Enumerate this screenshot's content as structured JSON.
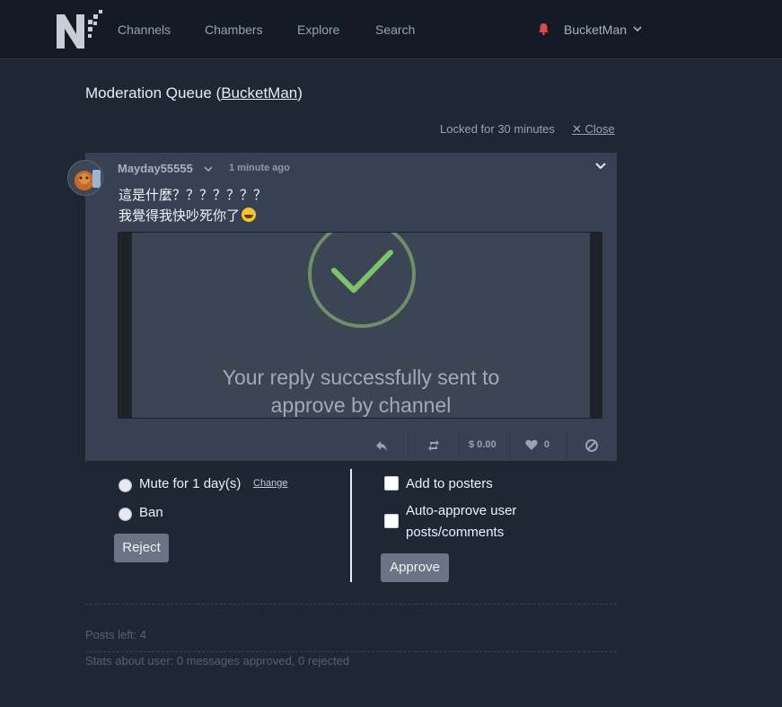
{
  "nav": {
    "links": [
      "Channels",
      "Chambers",
      "Explore",
      "Search"
    ],
    "user": "BucketMan"
  },
  "page": {
    "title_prefix": "Moderation Queue (",
    "title_user": "BucketMan",
    "title_suffix": ")",
    "locked_text": "Locked for 30 minutes",
    "close_label": "✕ Close"
  },
  "post": {
    "author": "Mayday55555",
    "time": "1 minute ago",
    "lines": [
      "這是什麼？？？？？？？",
      "我覺得我快吵死你了"
    ],
    "image_text": [
      "Your reply successfully sent to",
      "approve by channel"
    ],
    "tip_amount": "$ 0.00",
    "like_count": "0"
  },
  "moderation": {
    "mute_label": "Mute for 1 day(s)",
    "change_label": "Change",
    "ban_label": "Ban",
    "reject_label": "Reject",
    "add_posters_label": "Add to posters",
    "auto_approve_line1": "Auto-approve user",
    "auto_approve_line2": "posts/comments",
    "approve_label": "Approve"
  },
  "footer": {
    "posts_left": "Posts left: 4",
    "stats": "Stats about user: 0 messages approved, 0 rejected"
  },
  "colors": {
    "background": "#1f2735",
    "topbar": "#141b27",
    "card": "#374153",
    "button": "#6b7384",
    "notification": "#e0484f",
    "check_green": "#7cc36a"
  }
}
